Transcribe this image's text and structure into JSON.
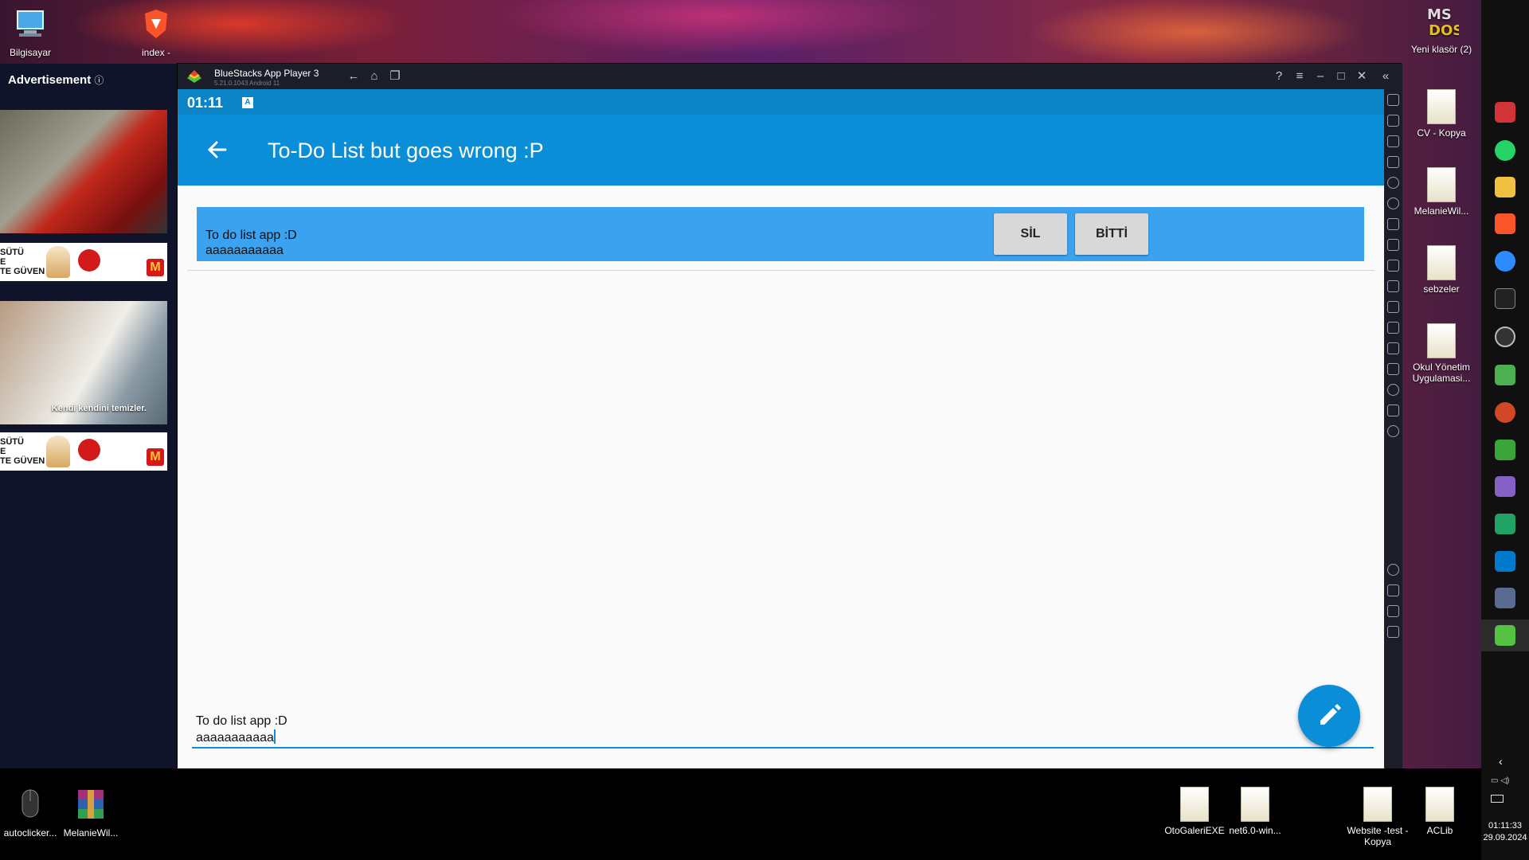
{
  "desktop": {
    "top_icons": [
      {
        "label": "Bilgisayar"
      },
      {
        "label": "index -"
      }
    ],
    "right_top_icon": {
      "label": "Yeni klasör (2)",
      "logo": "MS DOS"
    },
    "right_column": [
      {
        "label": "CV - Kopya"
      },
      {
        "label": "MelanieWil..."
      },
      {
        "label": "sebzeler"
      },
      {
        "label": "Okul Yönetim Uygulamasi..."
      }
    ],
    "bottom_icons": [
      {
        "label": "autoclicker..."
      },
      {
        "label": "MelanieWil..."
      },
      {
        "label": "OtoGaleriEXE"
      },
      {
        "label": "net6.0-win..."
      },
      {
        "label": "Website -test - Kopya"
      },
      {
        "label": "ACLib"
      }
    ]
  },
  "ads": {
    "title": "Advertisement",
    "banner_lines": [
      "SÜTÜ",
      "E",
      "TE GÜVEN"
    ],
    "room_caption": "Kendi kendini temizler."
  },
  "bluestacks": {
    "title": "BlueStacks App Player 3",
    "version": "5.21.0.1043  Android 11"
  },
  "android": {
    "time": "01:11",
    "status_icon": "A",
    "app_title": "To-Do List but goes wrong :P",
    "todo_items": [
      {
        "line1": "To do list app :D",
        "line2": "aaaaaaaaaaa",
        "delete_label": "SİL",
        "done_label": "BİTTİ"
      }
    ],
    "input": {
      "line1": "To do list app :D",
      "line2": "aaaaaaaaaaa"
    }
  },
  "taskbar": {
    "time": "01:11:33",
    "date": "29.09.2024"
  },
  "colors": {
    "appbar": "#0b8ed8",
    "statusbar": "#0a83c7",
    "todo_item": "#3ba2f0"
  }
}
